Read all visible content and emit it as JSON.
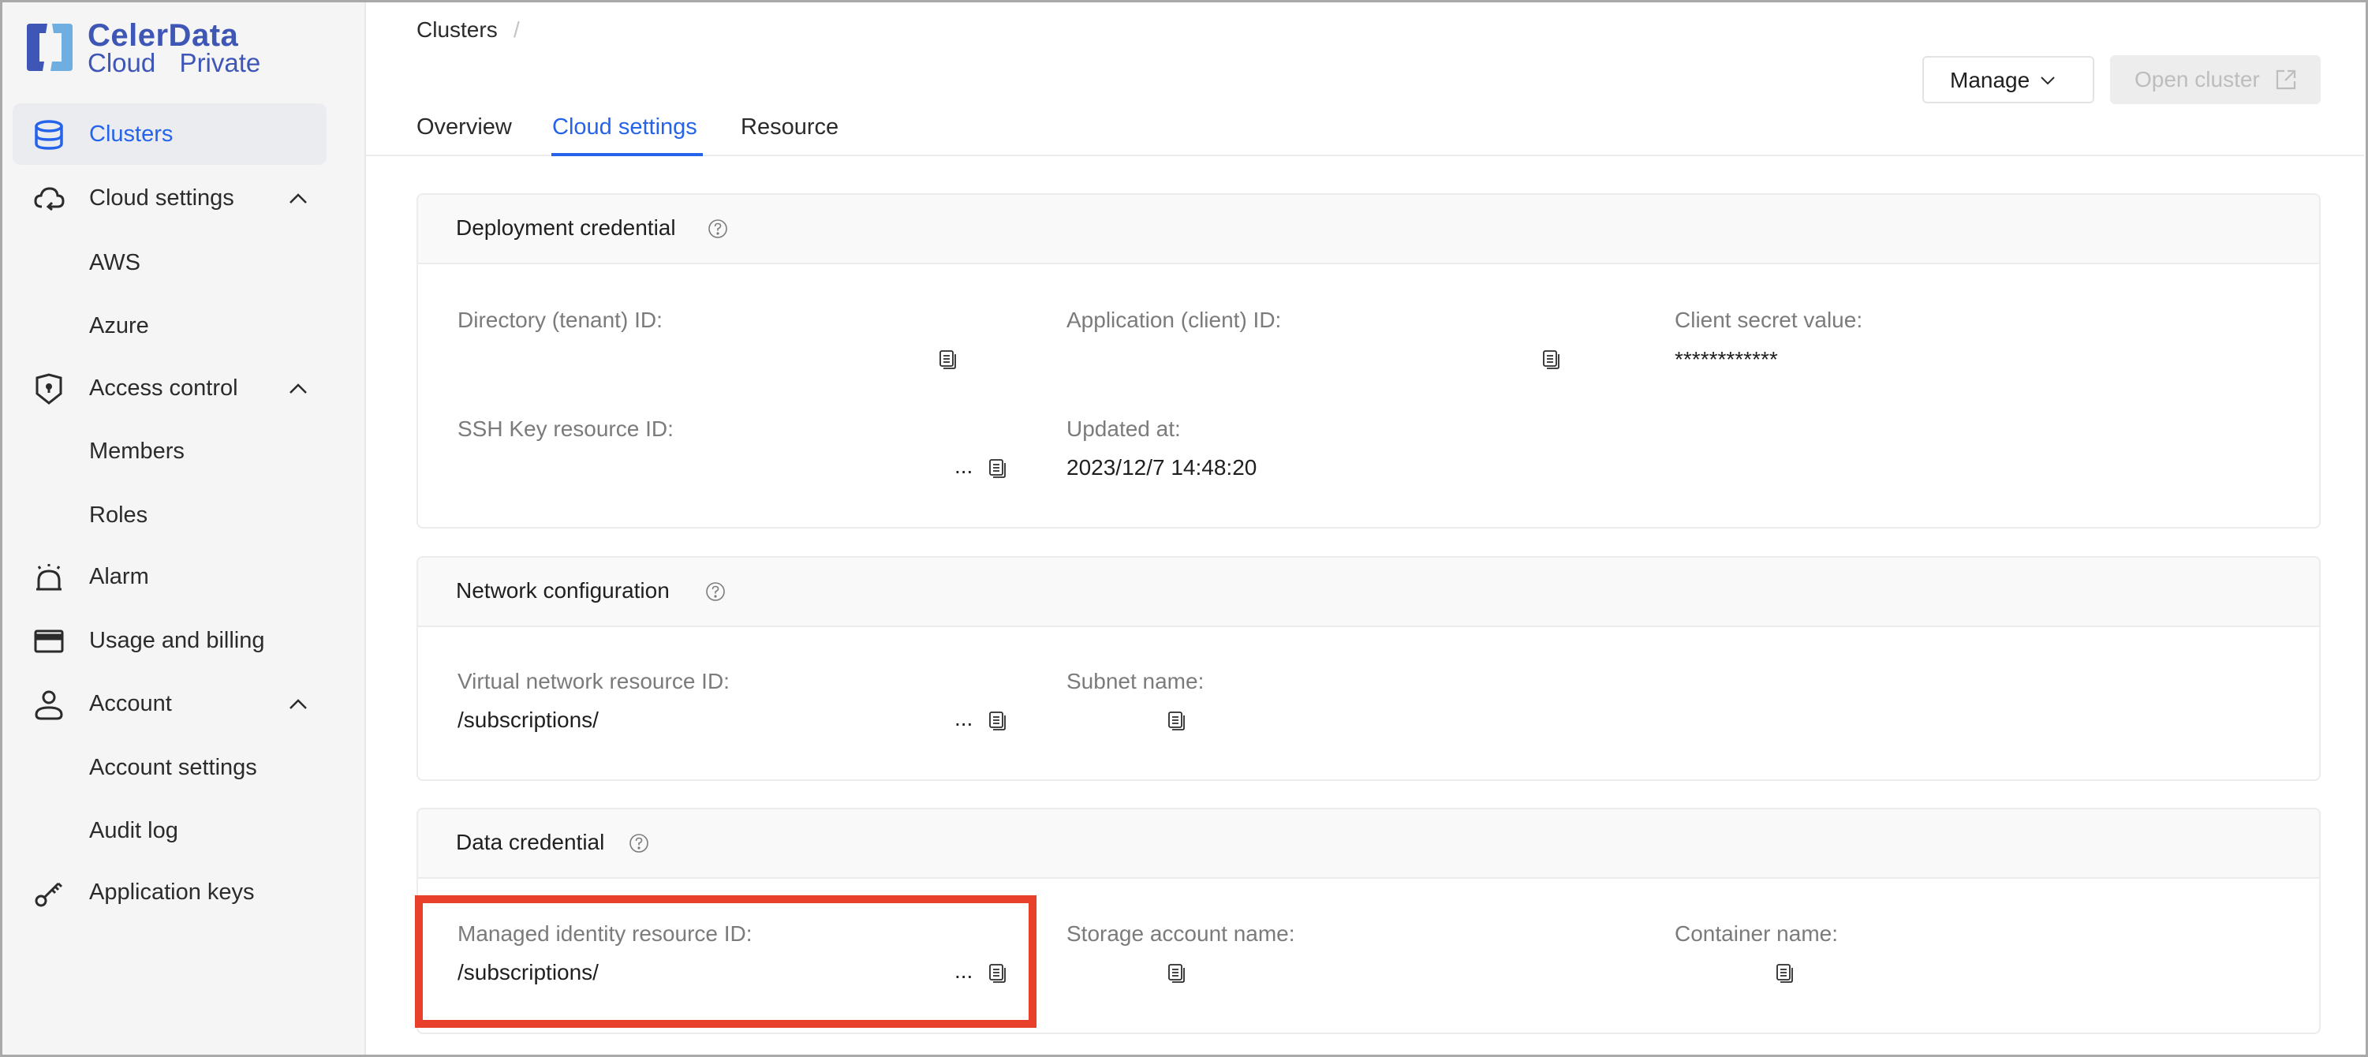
{
  "brand": {
    "name": "CelerData",
    "product": "Cloud  Private",
    "colors": {
      "dark": "#3e56b5",
      "light": "#6eaee0"
    }
  },
  "accent_color": "#2563eb",
  "highlight_color": "#e8402a",
  "sidebar": {
    "items": [
      {
        "label": "Clusters",
        "icon": "database-icon",
        "active": true
      },
      {
        "label": "Cloud settings",
        "icon": "cloud-sync-icon",
        "expanded": true,
        "children": [
          {
            "label": "AWS"
          },
          {
            "label": "Azure"
          }
        ]
      },
      {
        "label": "Access control",
        "icon": "shield-lock-icon",
        "expanded": true,
        "children": [
          {
            "label": "Members"
          },
          {
            "label": "Roles"
          }
        ]
      },
      {
        "label": "Alarm",
        "icon": "alarm-icon"
      },
      {
        "label": "Usage and billing",
        "icon": "credit-card-icon"
      },
      {
        "label": "Account",
        "icon": "user-icon",
        "expanded": true,
        "children": [
          {
            "label": "Account settings"
          },
          {
            "label": "Audit log"
          }
        ]
      },
      {
        "label": "Application keys",
        "icon": "key-icon"
      }
    ]
  },
  "breadcrumb": {
    "items": [
      "Clusters"
    ],
    "separator": "/"
  },
  "tabs": [
    {
      "label": "Overview",
      "active": false
    },
    {
      "label": "Cloud settings",
      "active": true
    },
    {
      "label": "Resource",
      "active": false
    }
  ],
  "actions": {
    "manage_label": "Manage",
    "open_cluster_label": "Open cluster",
    "open_cluster_disabled": true
  },
  "sections": {
    "deployment": {
      "title": "Deployment credential",
      "fields": [
        {
          "label": "Directory (tenant) ID:",
          "value": "",
          "copyable": true
        },
        {
          "label": "Application (client) ID:",
          "value": "",
          "copyable": true
        },
        {
          "label": "Client secret value:",
          "value": "************"
        },
        {
          "label": "SSH Key resource ID:",
          "value": "",
          "truncated": "...",
          "copyable": true
        },
        {
          "label": "Updated at:",
          "value": "2023/12/7 14:48:20"
        }
      ]
    },
    "network": {
      "title": "Network configuration",
      "fields": [
        {
          "label": "Virtual network resource ID:",
          "value": "/subscriptions/",
          "truncated": "...",
          "copyable": true
        },
        {
          "label": "Subnet name:",
          "value": "",
          "copyable": true
        }
      ]
    },
    "data": {
      "title": "Data credential",
      "fields": [
        {
          "label": "Managed identity resource ID:",
          "value": "/subscriptions/",
          "truncated": "...",
          "copyable": true,
          "highlighted": true
        },
        {
          "label": "Storage account name:",
          "value": "",
          "copyable": true
        },
        {
          "label": "Container name:",
          "value": "",
          "copyable": true
        }
      ]
    }
  }
}
